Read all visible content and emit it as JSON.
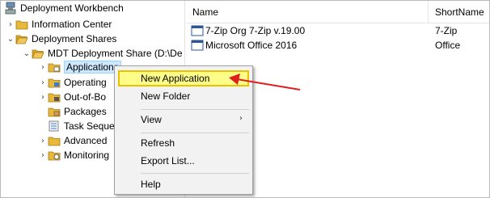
{
  "tree": {
    "items": [
      {
        "label": "Deployment Workbench",
        "chevron": ""
      },
      {
        "label": "Information Center",
        "chevron": "›"
      },
      {
        "label": "Deployment Shares",
        "chevron": "⌄"
      },
      {
        "label": "MDT Deployment Share (D:\\De",
        "chevron": "⌄"
      },
      {
        "label": "Applications",
        "chevron": "›"
      },
      {
        "label": "Operating",
        "chevron": "›"
      },
      {
        "label": "Out-of-Bo",
        "chevron": "›"
      },
      {
        "label": "Packages",
        "chevron": ""
      },
      {
        "label": "Task Seque",
        "chevron": ""
      },
      {
        "label": "Advanced",
        "chevron": "›"
      },
      {
        "label": "Monitoring",
        "chevron": "›"
      }
    ]
  },
  "list": {
    "columns": [
      "Name",
      "ShortName"
    ],
    "rows": [
      {
        "name": "7-Zip Org 7-Zip v.19.00",
        "short": "7-Zip"
      },
      {
        "name": "Microsoft Office 2016",
        "short": "Office"
      }
    ]
  },
  "context_menu": {
    "items": [
      "New Application",
      "New Folder",
      "View",
      "Refresh",
      "Export List...",
      "Help"
    ],
    "submenu_arrow": "›"
  },
  "colors": {
    "highlight_fill": "#fffd8a",
    "highlight_border": "#e8c400",
    "annotation_arrow": "#e02020",
    "selection": "#cce8ff"
  }
}
